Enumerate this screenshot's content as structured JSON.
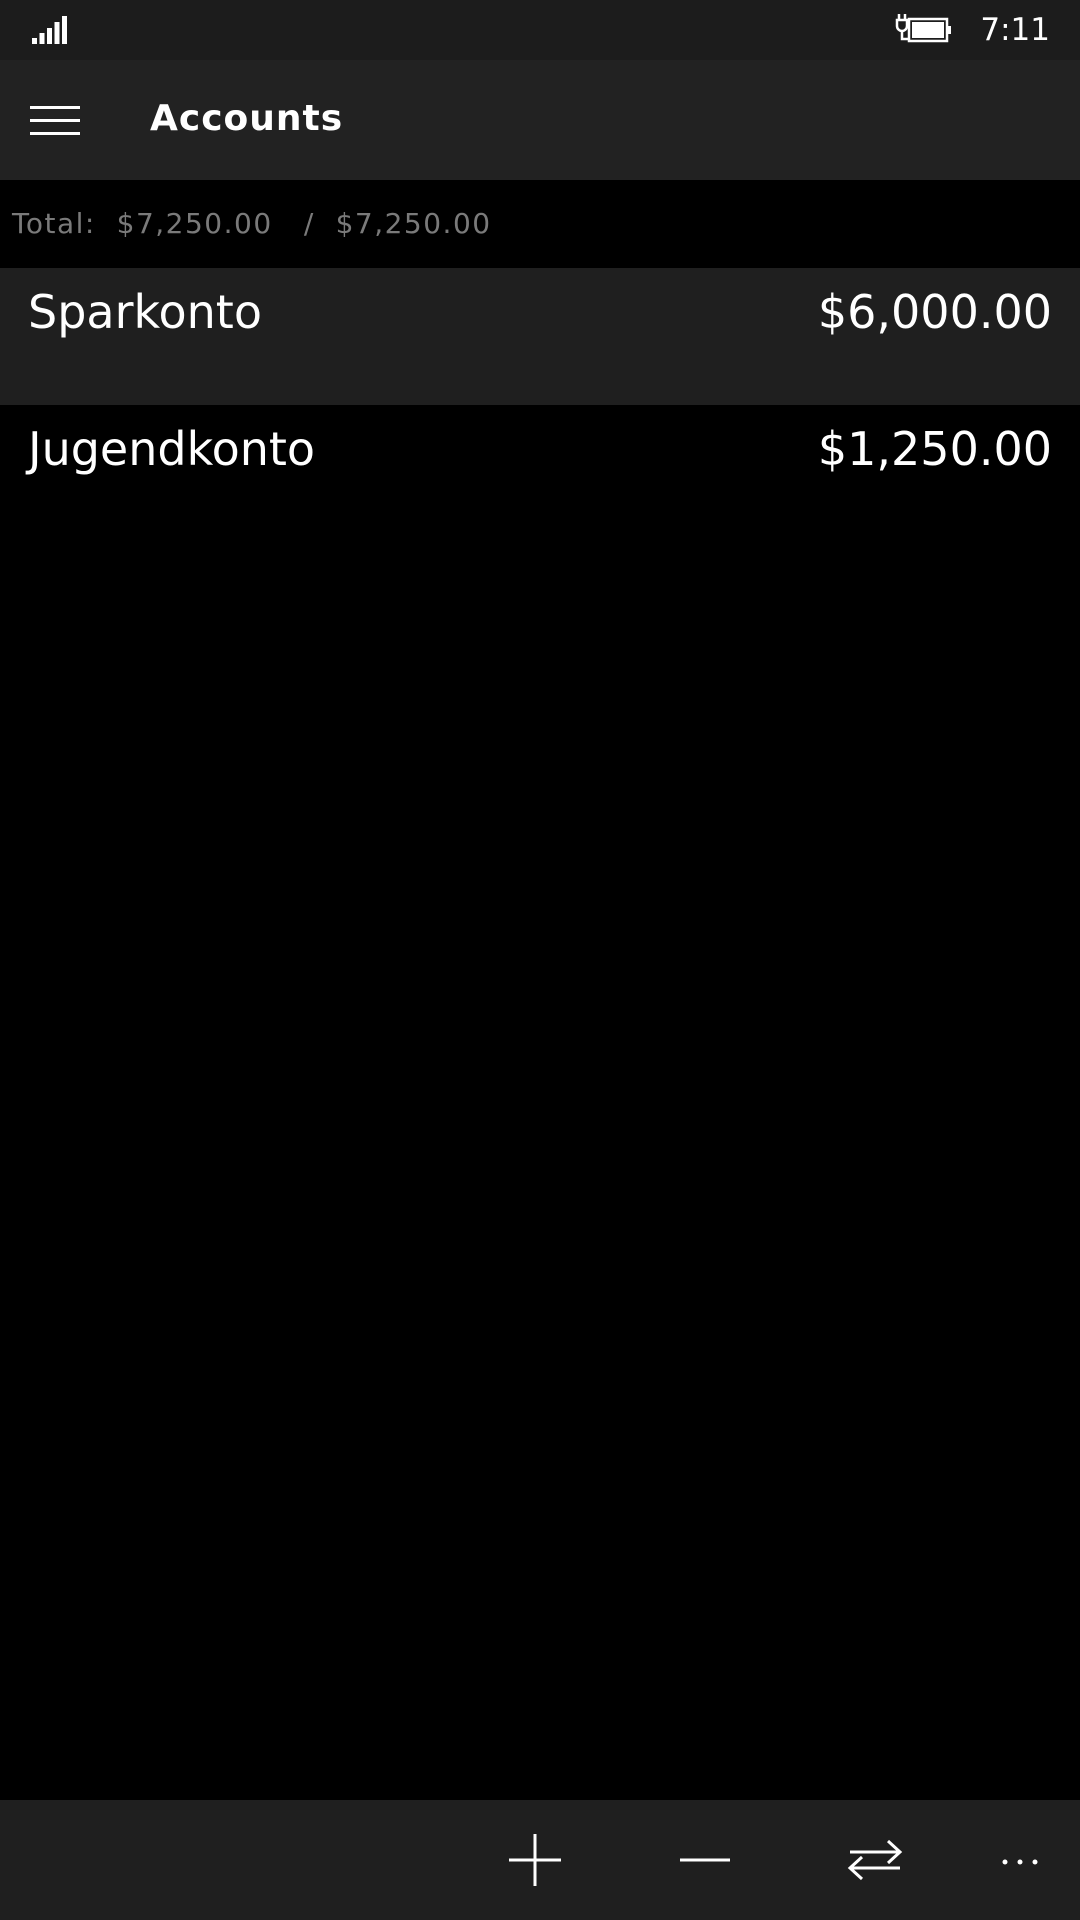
{
  "status_bar": {
    "time": "7:11",
    "signal_icon": "signal-bars-icon",
    "battery_icon": "battery-charging-icon"
  },
  "header": {
    "title": "Accounts",
    "menu_icon": "hamburger-menu-icon"
  },
  "summary": {
    "total_label": "Total:  $7,250.00   /  $7,250.00"
  },
  "accounts": [
    {
      "name": "Sparkonto",
      "balance": "$6,000.00"
    },
    {
      "name": "Jugendkonto",
      "balance": "$1,250.00"
    }
  ],
  "app_bar": {
    "buttons": [
      {
        "icon": "add-icon"
      },
      {
        "icon": "subtract-icon"
      },
      {
        "icon": "transfer-icon"
      },
      {
        "icon": "more-icon"
      }
    ]
  },
  "colors": {
    "background": "#000000",
    "header": "#222222",
    "selected_row": "#1f1f1f",
    "muted_text": "#7a7a7a"
  }
}
